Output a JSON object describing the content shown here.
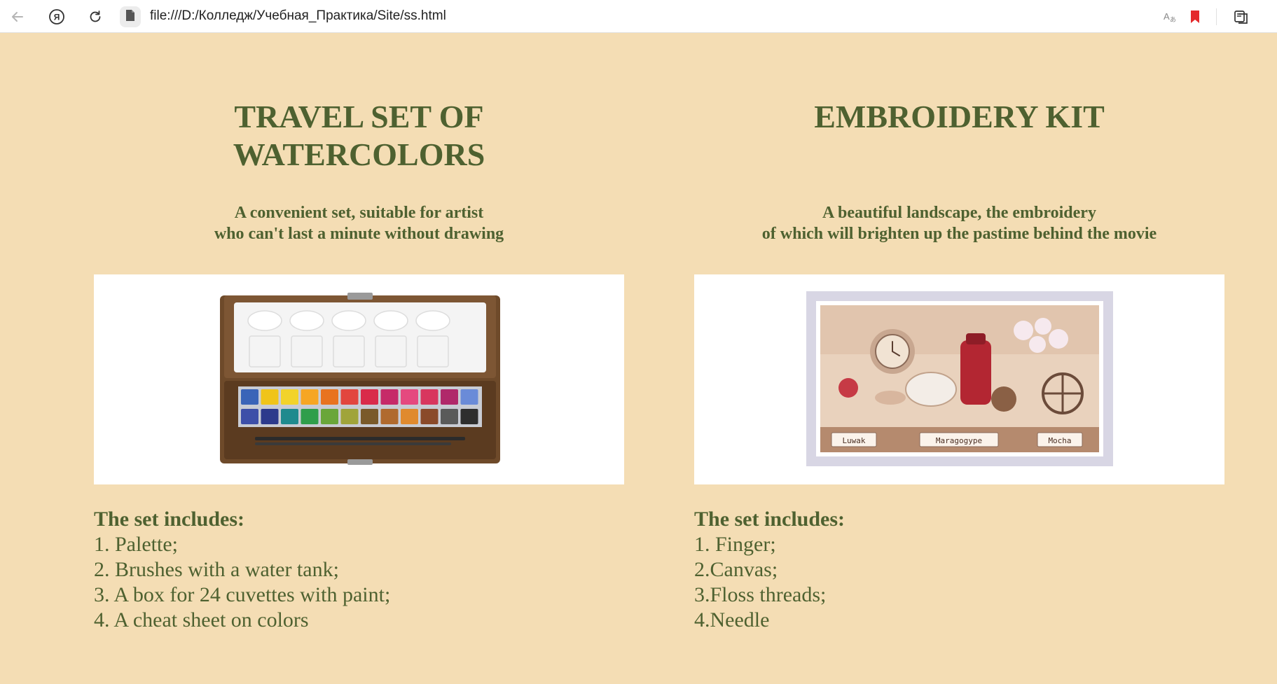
{
  "browser": {
    "url": "file:///D:/Колледж/Учебная_Практика/Site/ss.html",
    "icons": [
      "back-icon",
      "yandex-icon",
      "reload-icon",
      "file-icon",
      "translate-icon",
      "bookmark-icon",
      "collections-icon"
    ],
    "bookmark_color": "#e4292b"
  },
  "colors": {
    "background": "#f4ddb4",
    "text": "#4e6130"
  },
  "products": [
    {
      "title": "TRAVEL SET OF\nWATERCOLORS",
      "description": "A convenient set, suitable for artist\nwho can't last a minute without drawing",
      "image_alt": "watercolor-set-image",
      "includes_heading": "The set includes:",
      "items": [
        "1. Palette;",
        "2. Brushes with a water tank;",
        "3. A box for 24 cuvettes with paint;",
        "4. A cheat sheet on colors"
      ]
    },
    {
      "title": "EMBROIDERY KIT",
      "description": "A beautiful landscape, the embroidery\nof which will brighten up the pastime behind the movie",
      "image_alt": "embroidery-kit-image",
      "image_labels": [
        "Luwak",
        "Maragogype",
        "Mocha"
      ],
      "includes_heading": "The set includes:",
      "items": [
        "1. Finger;",
        "2.Canvas;",
        "3.Floss threads;",
        "4.Needle"
      ]
    }
  ]
}
